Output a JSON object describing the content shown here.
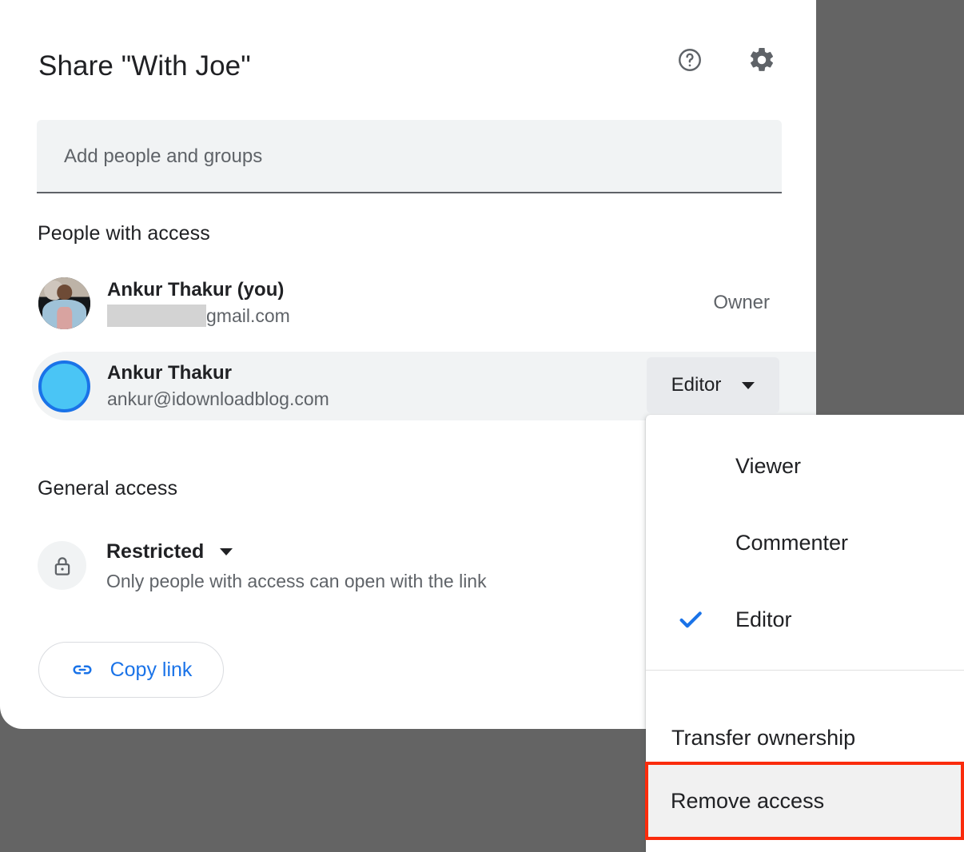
{
  "dialog": {
    "title": "Share \"With Joe\"",
    "help_icon": "help-circle-icon",
    "settings_icon": "gear-icon"
  },
  "add_people": {
    "placeholder": "Add people and groups",
    "value": ""
  },
  "people_section": {
    "heading": "People with access",
    "people": [
      {
        "name": "Ankur Thakur (you)",
        "email_suffix": "gmail.com",
        "email_redacted": true,
        "role": "Owner",
        "avatar_type": "photo"
      },
      {
        "name": "Ankur Thakur",
        "email": "ankur@idownloadblog.com",
        "role": "Editor",
        "avatar_type": "blue-circle"
      }
    ]
  },
  "general_access": {
    "heading": "General access",
    "lock_icon": "lock-icon",
    "selected": "Restricted",
    "description": "Only people with access can open with the link",
    "copy_link_label": "Copy link",
    "copy_link_icon": "link-icon"
  },
  "role_menu": {
    "items": [
      {
        "label": "Viewer",
        "checked": false
      },
      {
        "label": "Commenter",
        "checked": false
      },
      {
        "label": "Editor",
        "checked": true
      }
    ],
    "transfer_label": "Transfer ownership",
    "remove_label": "Remove access",
    "checkmark_icon": "check-icon"
  },
  "colors": {
    "backdrop": "#646464",
    "accent_blue": "#1a73e8",
    "highlight_red": "#fa2b0c",
    "row_highlight": "#f1f3f4",
    "text_primary": "#202124",
    "text_secondary": "#5f6368"
  }
}
